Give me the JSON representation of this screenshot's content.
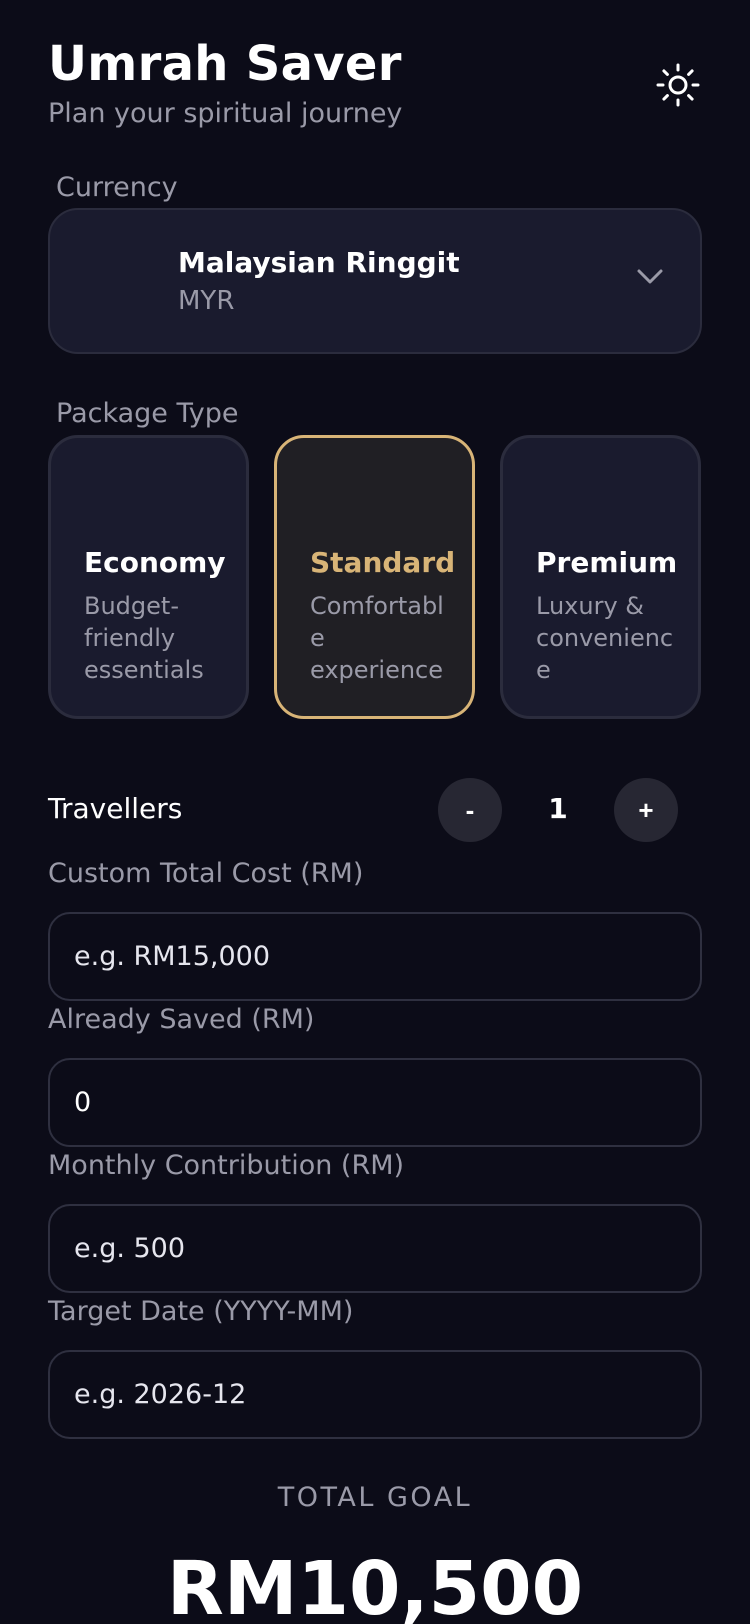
{
  "header": {
    "title": "Umrah Saver",
    "subtitle": "Plan your spiritual journey",
    "theme_icon": "sun-icon"
  },
  "currency": {
    "label": "Currency",
    "selected_name": "Malaysian Ringgit",
    "selected_code": "MYR",
    "dropdown_icon": "chevron-down-icon"
  },
  "package": {
    "label": "Package Type",
    "selected": "Standard",
    "accent_color": "#d8b477",
    "options": [
      {
        "name": "Economy",
        "description": "Budget-\nfriendly\nessentials"
      },
      {
        "name": "Standard",
        "description": "Comfortabl\ne\nexperience"
      },
      {
        "name": "Premium",
        "description": "Luxury &\nconvenienc\ne"
      }
    ]
  },
  "travellers": {
    "label": "Travellers",
    "value": "1",
    "decrement_label": "-",
    "increment_label": "+"
  },
  "fields": {
    "custom_cost": {
      "label": "Custom Total Cost (RM)",
      "placeholder": "e.g. RM15,000",
      "value": ""
    },
    "already_saved": {
      "label": "Already Saved (RM)",
      "placeholder": "",
      "value": "0"
    },
    "monthly_contribution": {
      "label": "Monthly Contribution (RM)",
      "placeholder": "e.g. 500",
      "value": ""
    },
    "target_date": {
      "label": "Target Date (YYYY-MM)",
      "placeholder": "e.g. 2026-12",
      "value": ""
    }
  },
  "summary": {
    "goal_label": "TOTAL GOAL",
    "goal_value": "RM10,500"
  },
  "colors": {
    "background": "#0c0c18",
    "card": "#1a1b2e",
    "muted_text": "#9a9aa8"
  }
}
